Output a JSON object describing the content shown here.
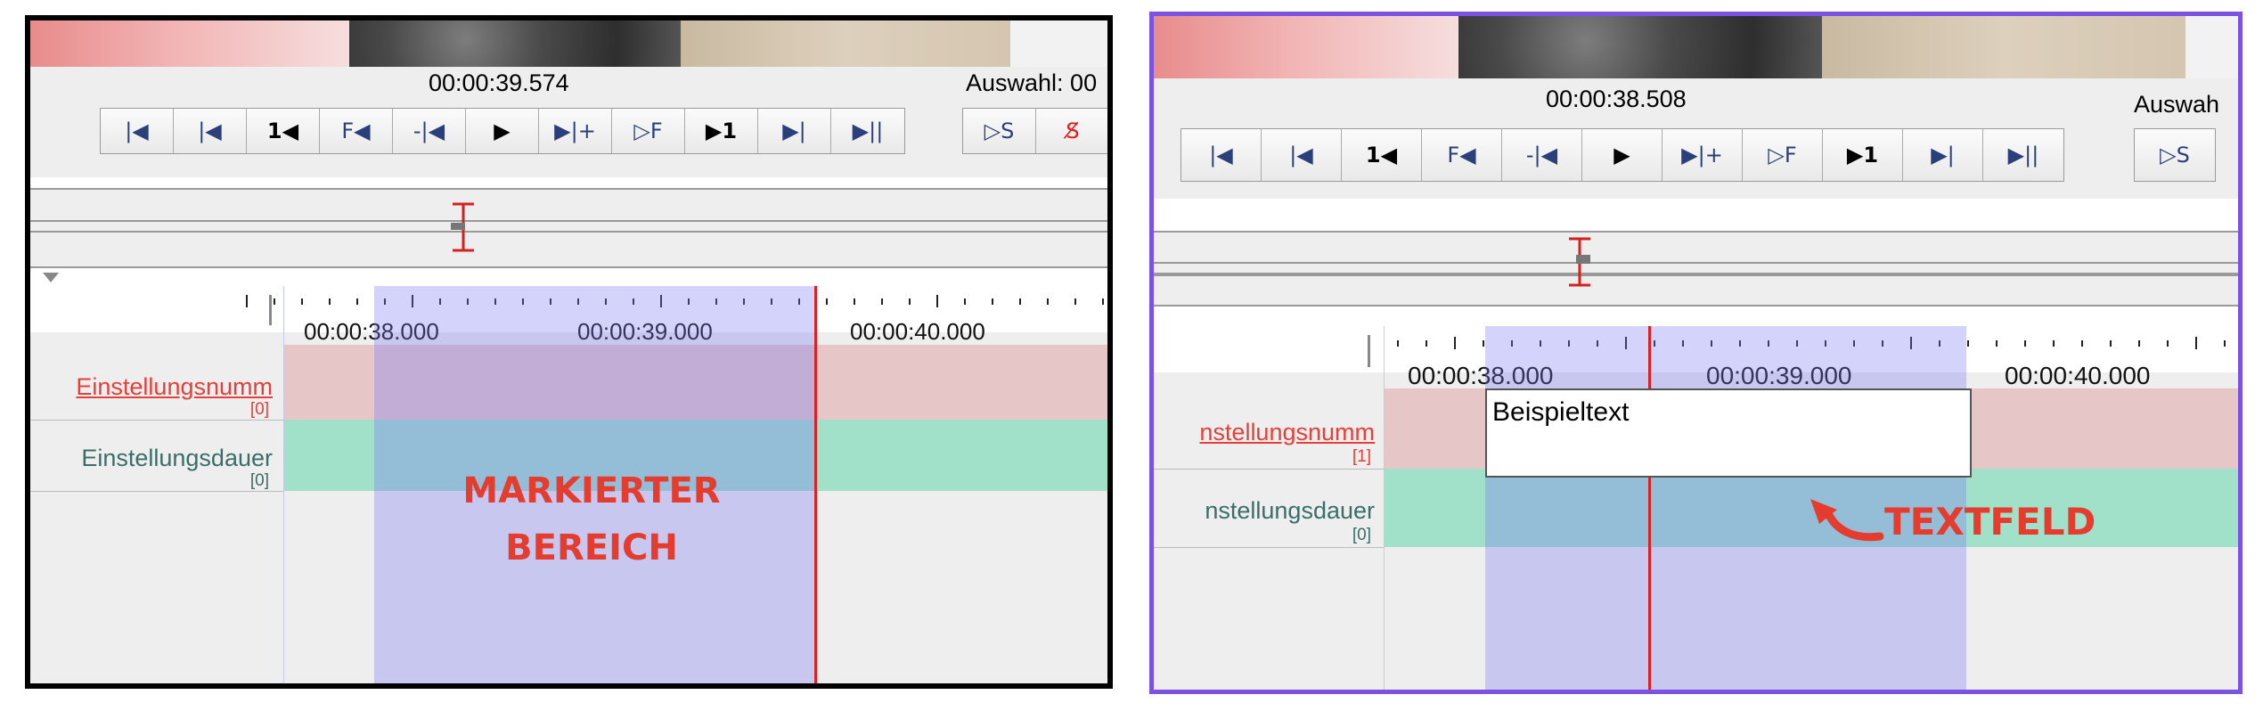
{
  "left_panel": {
    "time": "00:00:39.574",
    "selection_label": "Auswahl: 00",
    "buttons": [
      "|◀",
      "|◀",
      "1◀",
      "F◀",
      "-|◀",
      "▶",
      "▶|+",
      "▷F",
      "▶1",
      "▶|",
      "▶||"
    ],
    "extra_buttons": [
      "▷S",
      "S̸"
    ],
    "ruler_labels": [
      "00:00:38.000",
      "00:00:39.000",
      "00:00:40.000"
    ],
    "tracks": [
      {
        "name": "Einstellungsnumm",
        "index": "[0]",
        "color": "#e3413a",
        "fill": "#e6c6c6"
      },
      {
        "name": "Einstellungsdauer",
        "index": "[0]",
        "color": "#3a6e6a",
        "fill": "#a1e0c9"
      }
    ],
    "annotation_line1": "MARKIERTER",
    "annotation_line2": "BEREICH"
  },
  "right_panel": {
    "time": "00:00:38.508",
    "selection_label": "Auswah",
    "buttons": [
      "|◀",
      "|◀",
      "1◀",
      "F◀",
      "-|◀",
      "▶",
      "▶|+",
      "▷F",
      "▶1",
      "▶|",
      "▶||"
    ],
    "extra_buttons": [
      "▷S"
    ],
    "ruler_labels": [
      "00:00:38.000",
      "00:00:39.000",
      "00:00:40.000"
    ],
    "tracks": [
      {
        "name": "nstellungsnumm",
        "index": "[1]",
        "color": "#e3413a",
        "fill": "#e6c6c6"
      },
      {
        "name": "nstellungsdauer",
        "index": "[0]",
        "color": "#3a6e6a",
        "fill": "#a1e0c9"
      }
    ],
    "textfield_value": "Beispieltext",
    "annotation": "TEXTFELD"
  },
  "colors": {
    "accent_red": "#e43c2f",
    "cursor_red": "#e02020",
    "selection_blue": "#8c8cf5",
    "frame_purple": "#7b53e0"
  }
}
